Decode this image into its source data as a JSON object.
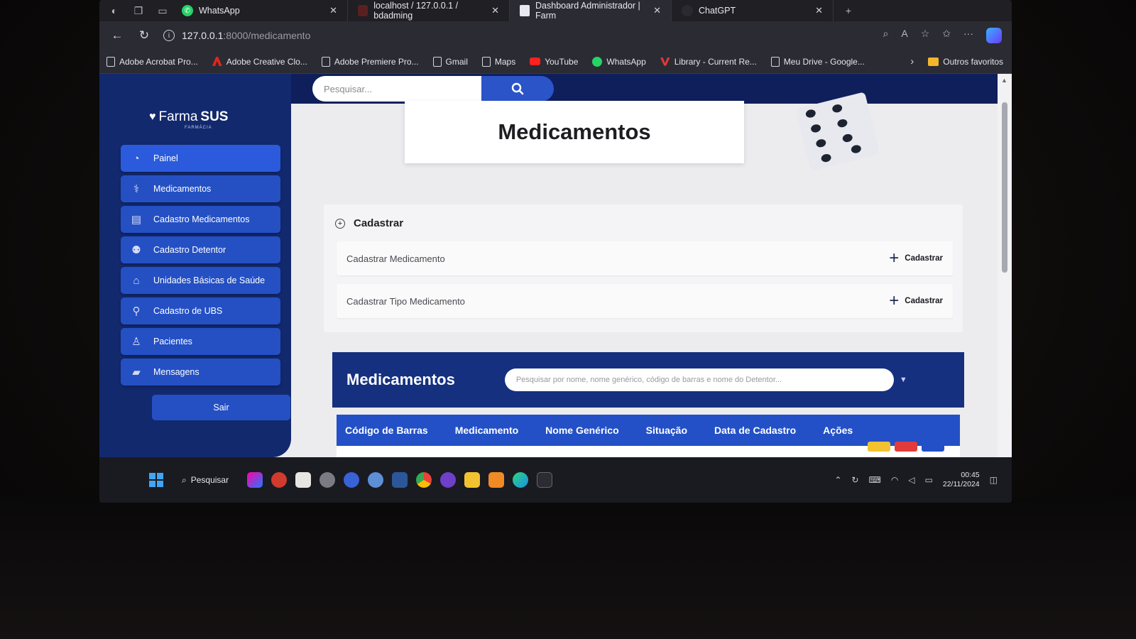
{
  "browser": {
    "tabs": [
      {
        "label": "WhatsApp",
        "icon": "whatsapp-icon",
        "active": false
      },
      {
        "label": "localhost / 127.0.0.1 / bdadming",
        "icon": "phpmyadmin-icon",
        "active": false
      },
      {
        "label": "Dashboard Administrador | Farm",
        "icon": "page-icon",
        "active": true
      },
      {
        "label": "ChatGPT",
        "icon": "chatgpt-icon",
        "active": false
      }
    ],
    "address": {
      "host": "127.0.0.1",
      "path": ":8000/medicamento"
    },
    "bookmarks": [
      {
        "label": "Adobe Acrobat Pro...",
        "icon": "page-icon"
      },
      {
        "label": "Adobe Creative Clo...",
        "icon": "adobe-icon"
      },
      {
        "label": "Adobe Premiere Pro...",
        "icon": "page-icon"
      },
      {
        "label": "Gmail",
        "icon": "page-icon"
      },
      {
        "label": "Maps",
        "icon": "page-icon"
      },
      {
        "label": "YouTube",
        "icon": "youtube-icon"
      },
      {
        "label": "WhatsApp",
        "icon": "whatsapp-icon"
      },
      {
        "label": "Library - Current Re...",
        "icon": "library-icon"
      },
      {
        "label": "Meu Drive - Google...",
        "icon": "page-icon"
      }
    ],
    "other_favorites": "Outros favoritos"
  },
  "header": {
    "search_placeholder": "Pesquisar..."
  },
  "sidebar": {
    "logo_main": "Farma",
    "logo_bold": "SUS",
    "logo_sub": "FARMÁCIA",
    "items": [
      {
        "label": "Painel",
        "icon": "dashboard-icon"
      },
      {
        "label": "Medicamentos",
        "icon": "medicine-icon"
      },
      {
        "label": "Cadastro Medicamentos",
        "icon": "medicine-register-icon"
      },
      {
        "label": "Cadastro Detentor",
        "icon": "users-icon"
      },
      {
        "label": "Unidades Básicas de Saúde",
        "icon": "health-unit-icon"
      },
      {
        "label": "Cadastro de UBS",
        "icon": "map-icon"
      },
      {
        "label": "Pacientes",
        "icon": "patient-icon"
      },
      {
        "label": "Mensagens",
        "icon": "message-icon"
      }
    ],
    "logout_label": "Sair"
  },
  "main": {
    "title": "Medicamentos",
    "cadastrar_panel": {
      "heading": "Cadastrar",
      "rows": [
        {
          "label": "Cadastrar Medicamento",
          "action": "Cadastrar"
        },
        {
          "label": "Cadastrar Tipo Medicamento",
          "action": "Cadastrar"
        }
      ]
    },
    "list": {
      "title": "Medicamentos",
      "search_placeholder": "Pesquisar por nome, nome genérico, código de barras e nome do Detentor...",
      "columns": [
        "Código de Barras",
        "Medicamento",
        "Nome Genérico",
        "Situação",
        "Data de Cadastro",
        "Ações"
      ]
    }
  },
  "taskbar": {
    "search_label": "Pesquisar",
    "time": "00:45",
    "date": "22/11/2024"
  },
  "colors": {
    "sidebar_bg": "#13296e",
    "menu_item": "#2450c4",
    "table_header": "#2350c6",
    "list_bar": "#15307f"
  }
}
